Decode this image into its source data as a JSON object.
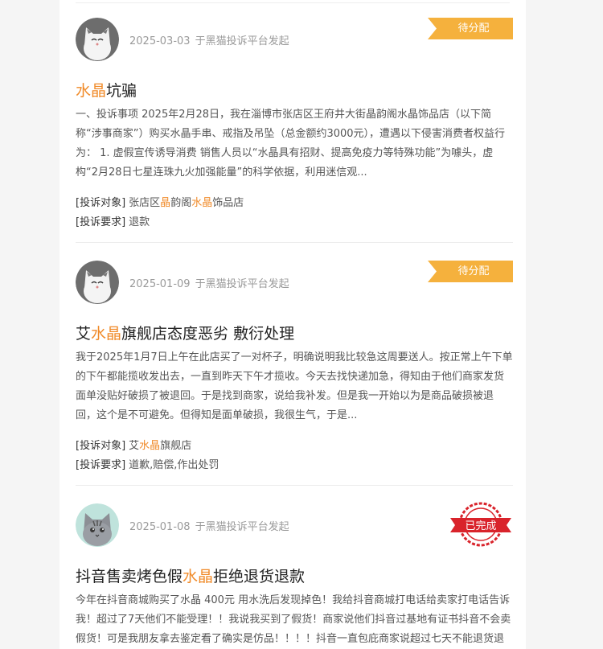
{
  "colors": {
    "highlight": "#f08a28",
    "pending_badge": "#f5b13d",
    "completed_stamp": "#d9232b"
  },
  "complaints": [
    {
      "avatar": "gray-cat-avatar",
      "date": "2025-03-03",
      "source": "于黑猫投诉平台发起",
      "status": "待分配",
      "title_pre": "",
      "title_hl": "水晶",
      "title_post": "坑骗",
      "description": "一、投诉事项 2025年2月28日，我在淄博市张店区王府井大街晶韵阁水晶饰品店（以下简称“涉事商家”）购买水晶手串、戒指及吊坠（总金额约3000元），遭遇以下侵害消费者权益行为： 1. 虚假宣传诱导消费 销售人员以“水晶具有招财、提高免疫力等特殊功能”为噱头，虚构“2月28日七星连珠九火加强能量”的科学依据，利用迷信观...",
      "target_label": "[投诉对象]",
      "target_parts": [
        "张店区",
        "晶",
        "韵阁",
        "水晶",
        "饰品店"
      ],
      "demand_label": "[投诉要求]",
      "demand": "退款"
    },
    {
      "avatar": "gray-cat-avatar",
      "date": "2025-01-09",
      "source": "于黑猫投诉平台发起",
      "status": "待分配",
      "title_pre": "艾",
      "title_hl": "水晶",
      "title_post": "旗舰店态度恶劣 敷衍处理",
      "description": "我于2025年1月7日上午在此店买了一对杯子，明确说明我比较急这周要送人。按正常上午下单的下午都能揽收发出去，一直到昨天下午才揽收。今天去找快递加急，得知由于他们商家发货面单没贴好破损了被退回。于是找到商家，说给我补发。但是我一开始以为是商品破损被退回，这个是不可避免。但得知是面单破损，我很生气，于是...",
      "target_label": "[投诉对象]",
      "target_parts": [
        "艾",
        "水晶",
        "旗舰店"
      ],
      "demand_label": "[投诉要求]",
      "demand": "道歉,赔偿,作出处罚"
    },
    {
      "avatar": "tabby-cat-avatar",
      "date": "2025-01-08",
      "source": "于黑猫投诉平台发起",
      "status": "已完成",
      "title_pre": "抖音售卖烤色假",
      "title_hl": "水晶",
      "title_post": "拒绝退货退款",
      "description": "今年在抖音商城购买了水晶 400元 用水洗后发现掉色！我给抖音商城打电话给卖家打电话告诉我！超过了7天他们不能受理！！我说我买到了假货！商家说他们抖音过基地有证书抖音不会卖假货！可是我朋友拿去鉴定看了确实是仿品！！！！抖音一直包庇商家说超过七天不能退货退"
    }
  ]
}
